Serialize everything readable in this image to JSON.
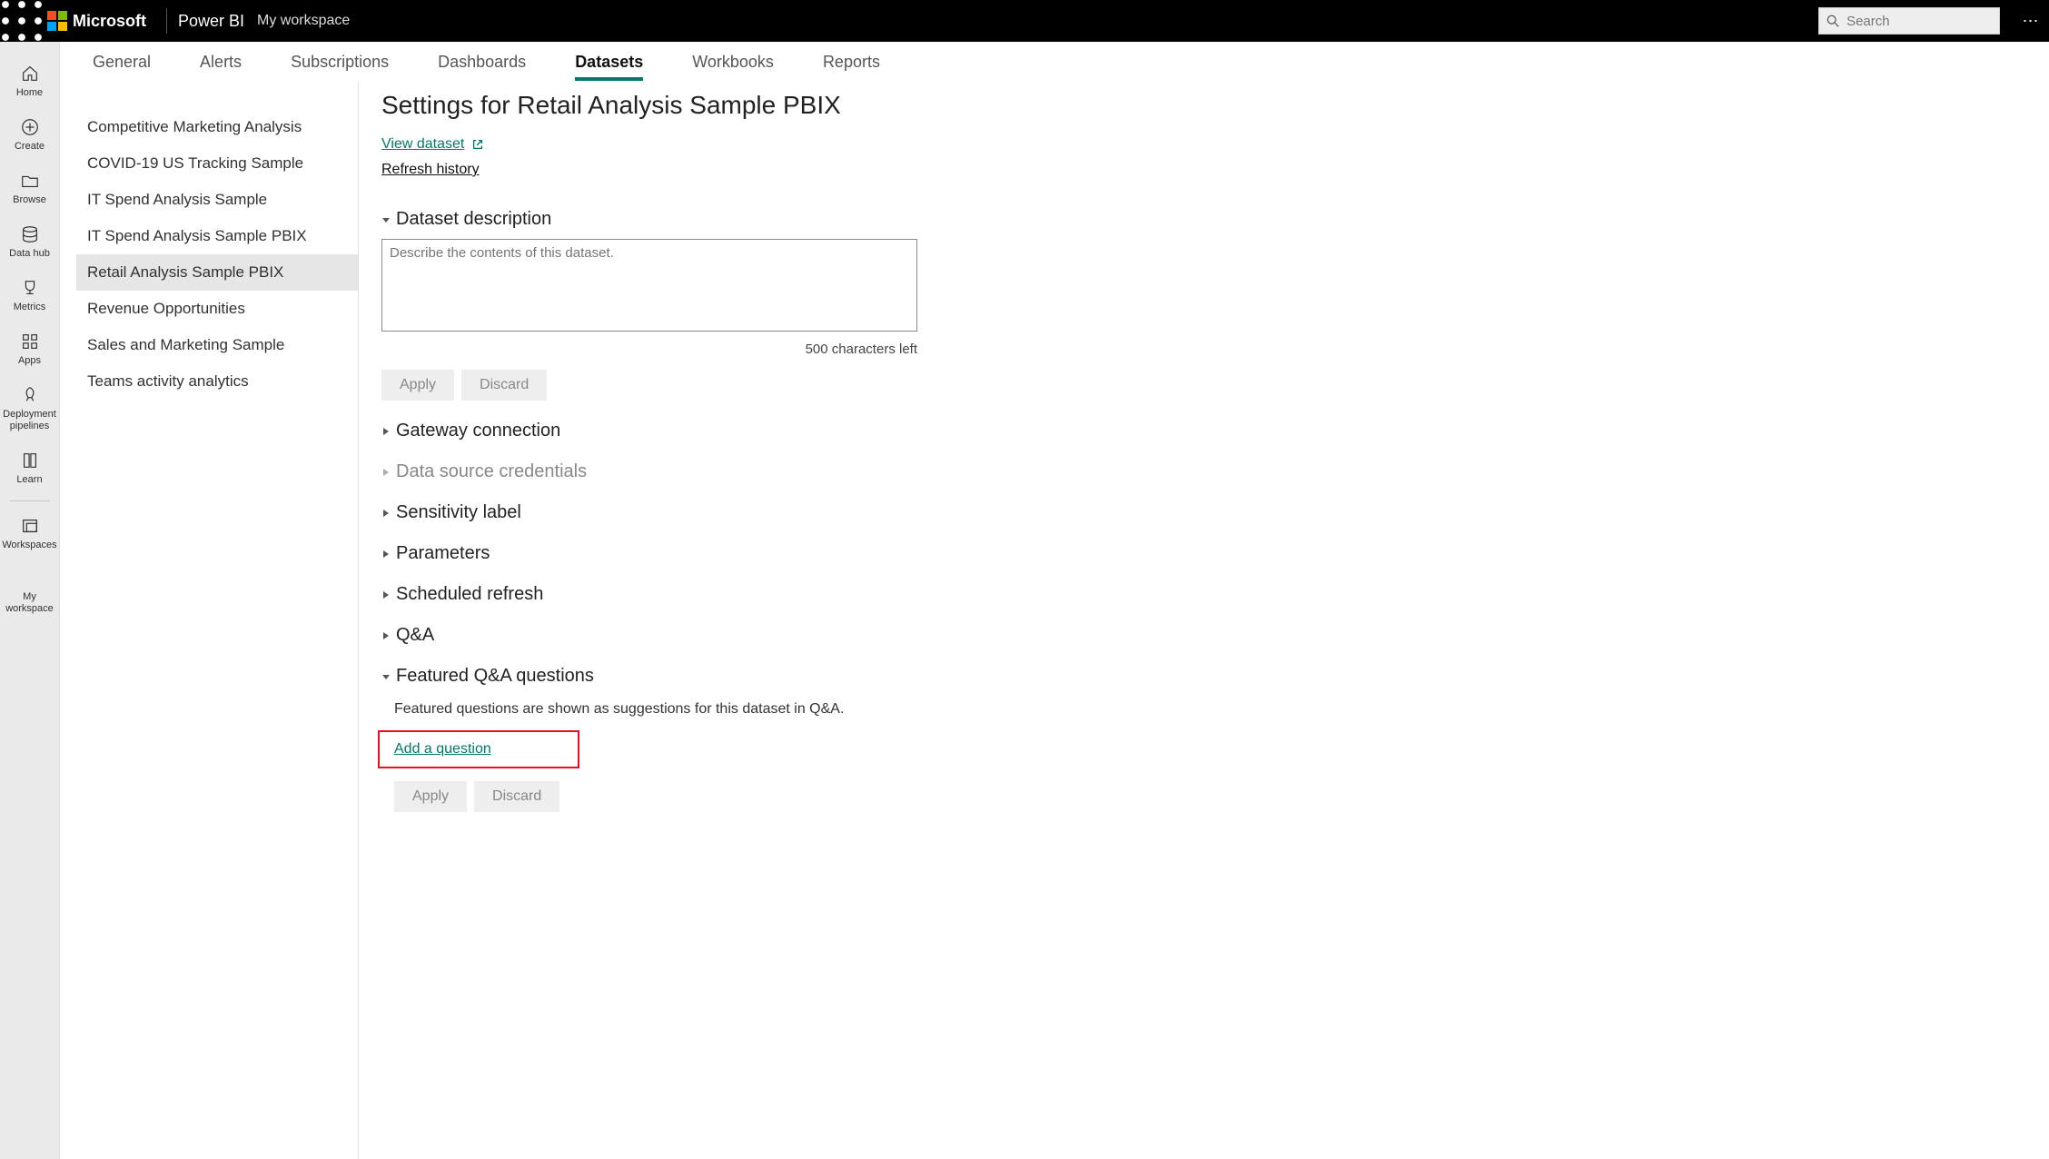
{
  "header": {
    "microsoft": "Microsoft",
    "app": "Power BI",
    "breadcrumb": "My workspace",
    "search_placeholder": "Search"
  },
  "leftnav": {
    "items": [
      {
        "label": "Home"
      },
      {
        "label": "Create"
      },
      {
        "label": "Browse"
      },
      {
        "label": "Data hub"
      },
      {
        "label": "Metrics"
      },
      {
        "label": "Apps"
      },
      {
        "label": "Deployment\npipelines"
      },
      {
        "label": "Learn"
      },
      {
        "label": "Workspaces"
      }
    ],
    "my_workspace": "My\nworkspace"
  },
  "tabs": {
    "items": [
      "General",
      "Alerts",
      "Subscriptions",
      "Dashboards",
      "Datasets",
      "Workbooks",
      "Reports"
    ],
    "active_index": 4
  },
  "datasets_list": {
    "items": [
      "Competitive Marketing Analysis",
      "COVID-19 US Tracking Sample",
      "IT Spend Analysis Sample",
      "IT Spend Analysis Sample PBIX",
      "Retail Analysis Sample PBIX",
      "Revenue Opportunities",
      "Sales and Marketing Sample",
      "Teams activity analytics"
    ],
    "selected_index": 4
  },
  "content": {
    "title": "Settings for Retail Analysis Sample PBIX",
    "view_dataset": "View dataset",
    "refresh_history": "Refresh history",
    "sections": {
      "description": {
        "label": "Dataset description",
        "placeholder": "Describe the contents of this dataset.",
        "char_left": "500 characters left",
        "apply": "Apply",
        "discard": "Discard"
      },
      "gateway": "Gateway connection",
      "credentials": "Data source credentials",
      "sensitivity": "Sensitivity label",
      "parameters": "Parameters",
      "scheduled": "Scheduled refresh",
      "qna": "Q&A",
      "featured": {
        "label": "Featured Q&A questions",
        "desc": "Featured questions are shown as suggestions for this dataset in Q&A.",
        "add": "Add a question",
        "apply": "Apply",
        "discard": "Discard"
      }
    }
  }
}
